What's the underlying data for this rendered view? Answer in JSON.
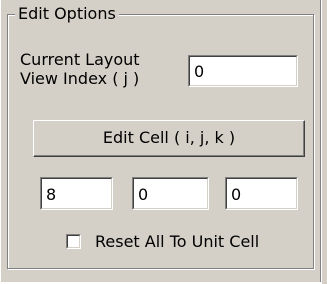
{
  "group": {
    "title": "Edit Options"
  },
  "layout_view": {
    "label_line1": "Current Layout",
    "label_line2": "View Index ( j )",
    "value": "0"
  },
  "edit_button": {
    "label": "Edit Cell ( i, j, k )"
  },
  "cell_fields": {
    "i_value": "8",
    "j_value": "0",
    "k_value": "0"
  },
  "reset_checkbox": {
    "label": "Reset All To Unit Cell",
    "checked": false
  }
}
